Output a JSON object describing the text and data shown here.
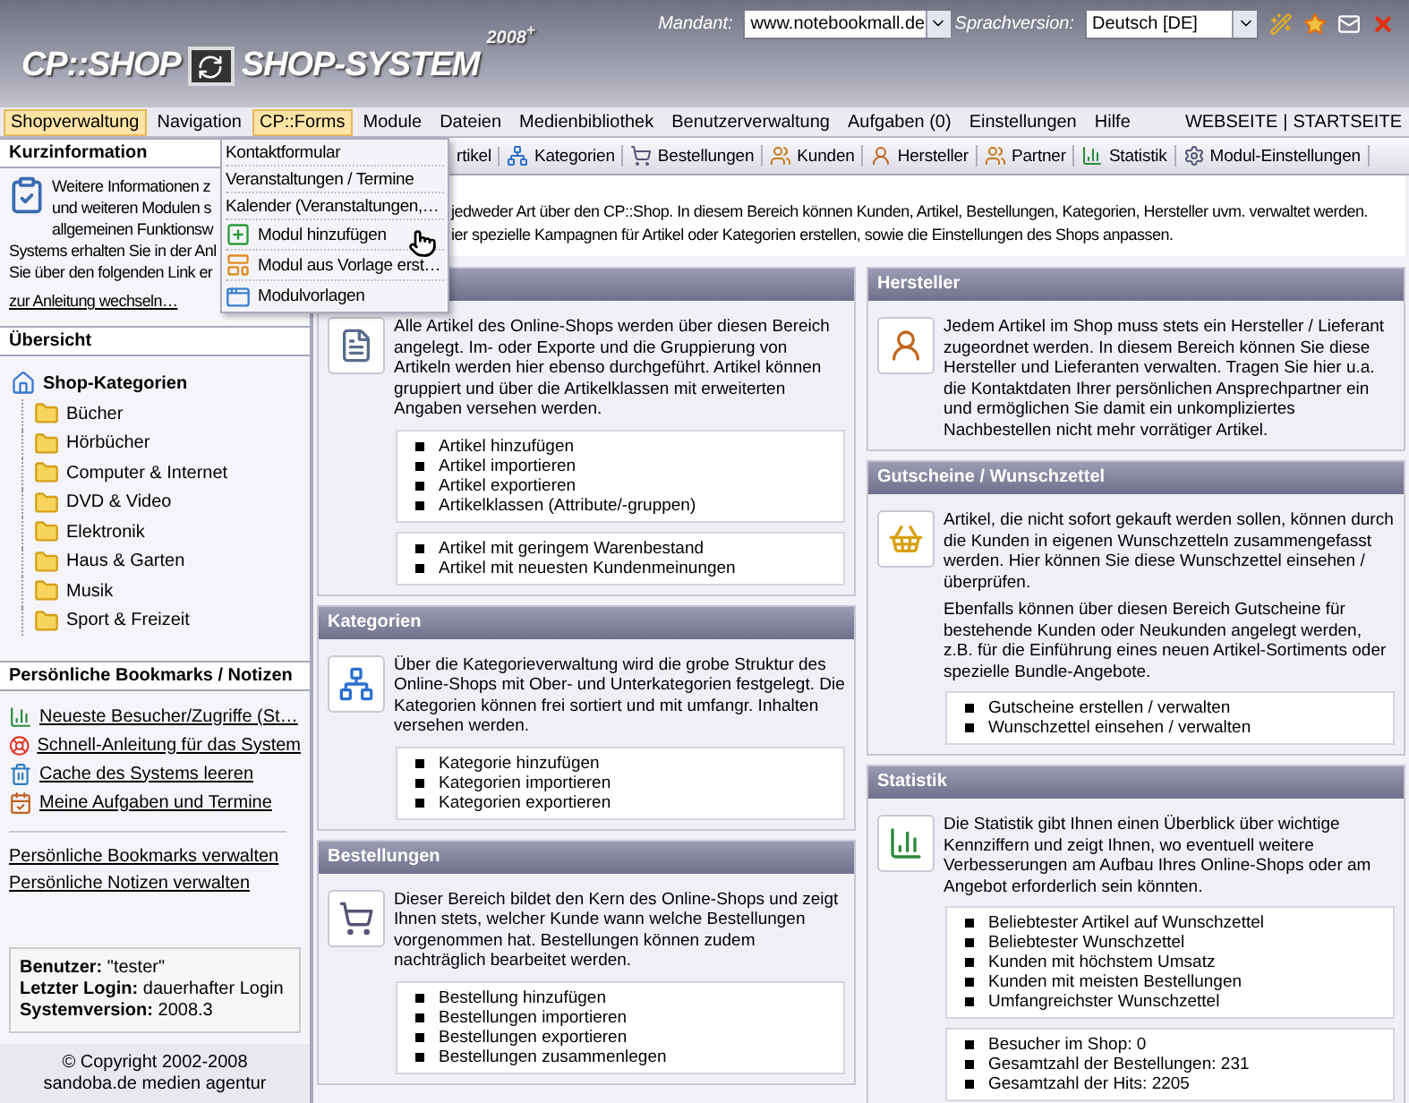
{
  "header": {
    "logo_left": "CP::SHOP",
    "logo_right": "SHOP-SYSTEM",
    "logo_year": "2008$^{+}$",
    "mandant_label": "Mandant:",
    "mandant_value": "www.notebookmall.de",
    "language_label": "Sprachversion:",
    "language_value": "Deutsch [DE]"
  },
  "menu": {
    "items": [
      {
        "label": "Shopverwaltung",
        "highlighted": true
      },
      {
        "label": "Navigation",
        "highlighted": false
      },
      {
        "label": "CP::Forms",
        "highlighted": true
      },
      {
        "label": "Module",
        "highlighted": false
      },
      {
        "label": "Dateien",
        "highlighted": false
      },
      {
        "label": "Medienbibliothek",
        "highlighted": false
      },
      {
        "label": "Benutzerverwaltung",
        "highlighted": false
      },
      {
        "label": "Aufgaben (0)",
        "highlighted": false
      },
      {
        "label": "Einstellungen",
        "highlighted": false
      },
      {
        "label": "Hilfe",
        "highlighted": false
      }
    ],
    "right_links": [
      "WEBSEITE",
      "STARTSEITE"
    ],
    "right_separator": "|"
  },
  "dropdown": {
    "items": [
      {
        "label": "Kontaktformular",
        "kind": "plain"
      },
      {
        "label": "Veranstaltungen / Termine",
        "kind": "plain"
      },
      {
        "label": "Kalender (Veranstaltungen,…",
        "kind": "plain"
      },
      {
        "label": "Modul hinzufügen",
        "kind": "add"
      },
      {
        "label": "Modul aus Vorlage erst…",
        "kind": "template"
      },
      {
        "label": "Modulvorlagen",
        "kind": "window"
      }
    ]
  },
  "sidebar": {
    "kurzinfo": {
      "title": "Kurzinformation",
      "lines": [
        "Weitere Informationen z",
        "und weiteren Modulen s",
        "allgemeinen Funktionsw"
      ],
      "more_lines": [
        "Systems erhalten Sie in der Anl",
        "Sie über den folgenden Link er"
      ],
      "link": "zur Anleitung wechseln…"
    },
    "overview": {
      "title": "Übersicht",
      "tree": {
        "label": "Shop-Kategorien",
        "children": [
          {
            "label": "Bücher"
          },
          {
            "label": "Hörbücher"
          },
          {
            "label": "Computer & Internet"
          },
          {
            "label": "DVD & Video"
          },
          {
            "label": "Elektronik"
          },
          {
            "label": "Haus & Garten"
          },
          {
            "label": "Musik"
          },
          {
            "label": "Sport & Freizeit"
          }
        ]
      }
    },
    "bookmarks": {
      "title": "Persönliche Bookmarks / Notizen",
      "links": [
        {
          "label": "Neueste Besucher/Zugriffe (St…",
          "kind": "chart"
        },
        {
          "label": "Schnell-Anleitung für das System",
          "kind": "help"
        },
        {
          "label": "Cache des Systems leeren",
          "kind": "bin"
        },
        {
          "label": "Meine Aufgaben und Termine",
          "kind": "calendar"
        }
      ],
      "manage_links": [
        "Persönliche Bookmarks verwalten",
        "Persönliche Notizen verwalten"
      ]
    },
    "user_info": [
      {
        "label": "Benutzer:",
        "value": "\"tester\""
      },
      {
        "label": "Letzter Login:",
        "value": "dauerhafter Login"
      },
      {
        "label": "Systemversion:",
        "value": "2008.3"
      }
    ],
    "copyright": [
      "© Copyright 2002-2008",
      "sandoba.de medien agentur"
    ]
  },
  "tabs": [
    {
      "label": "rtikel",
      "kind": "plain"
    },
    {
      "label": "Kategorien",
      "kind": "tree"
    },
    {
      "label": "Bestellungen",
      "kind": "cart"
    },
    {
      "label": "Kunden",
      "kind": "users"
    },
    {
      "label": "Hersteller",
      "kind": "user"
    },
    {
      "label": "Partner",
      "kind": "users"
    },
    {
      "label": "Statistik",
      "kind": "chart"
    },
    {
      "label": "Modul-Einstellungen",
      "kind": "settings"
    }
  ],
  "intro": [
    "jedweder Art über den CP::Shop. In diesem Bereich können Kunden, Artikel, Bestellungen, Kategorien, Hersteller uvm. verwaltet werden.",
    "ier spezielle Kampagnen für Artikel oder Kategorien erstellen, sowie die Einstellungen des Shops anpassen."
  ],
  "panels": {
    "left": [
      {
        "kind": "doc",
        "text": [
          "Alle Artikel des Online-Shops werden über diesen Bereich angelegt. Im- oder Exporte und die Gruppierung von Artikeln werden hier ebenso durchgeführt. Artikel können gruppiert und über die Artikelklassen mit erweiterten Angaben versehen werden."
        ],
        "lists": [
          [
            "Artikel hinzufügen",
            "Artikel importieren",
            "Artikel exportieren",
            "Artikelklassen (Attribute/-gruppen)"
          ],
          [
            "Artikel mit geringem Warenbestand",
            "Artikel mit neuesten Kundenmeinungen"
          ]
        ]
      },
      {
        "title": "Kategorien",
        "kind": "tree",
        "text": [
          "Über die Kategorieverwaltung wird die grobe Struktur des Online-Shops mit Ober- und Unterkategorien festgelegt. Die Kategorien können frei sortiert und mit umfangr. Inhalten versehen werden."
        ],
        "lists": [
          [
            "Kategorie hinzufügen",
            "Kategorien importieren",
            "Kategorien exportieren"
          ]
        ]
      },
      {
        "title": "Bestellungen",
        "kind": "cart",
        "text": [
          "Dieser Bereich bildet den Kern des Online-Shops und zeigt Ihnen stets, welcher Kunde wann welche Bestellungen vorgenommen hat. Bestellungen können zudem nachträglich bearbeitet werden."
        ],
        "lists": [
          [
            "Bestellung hinzufügen",
            "Bestellungen importieren",
            "Bestellungen exportieren",
            "Bestellungen zusammenlegen"
          ]
        ]
      }
    ],
    "right": [
      {
        "title": "Hersteller",
        "kind": "user",
        "text": [
          "Jedem Artikel im Shop muss stets ein Hersteller / Lieferant zugeordnet werden. In diesem Bereich können Sie diese Hersteller und Lieferanten verwalten. Tragen Sie hier u.a. die Kontaktdaten Ihrer persönlichen Ansprechpartner ein und ermöglichen Sie damit ein unkompliziertes Nachbestellen nicht mehr vorrätiger Artikel."
        ]
      },
      {
        "title": "Gutscheine / Wunschzettel",
        "kind": "basket",
        "text": [
          "Artikel, die nicht sofort gekauft werden sollen, können durch die Kunden in eigenen Wunschzetteln zusammengefasst werden. Hier können Sie diese Wunschzettel einsehen / überprüfen.",
          "Ebenfalls können über diesen Bereich Gutscheine für bestehende Kunden oder Neukunden angelegt werden, z.B. für die Einführung eines neuen Artikel-Sortiments oder spezielle Bundle-Angebote."
        ],
        "lists": [
          [
            "Gutscheine erstellen / verwalten",
            "Wunschzettel einsehen / verwalten"
          ]
        ]
      },
      {
        "title": "Statistik",
        "kind": "chart",
        "text": [
          "Die Statistik gibt Ihnen einen Überblick über wichtige Kennziffern und zeigt Ihnen, wo eventuell weitere Verbesserungen am Aufbau Ihres Online-Shops oder am Angebot erforderlich sein könnten."
        ],
        "lists": [
          [
            "Beliebtester Artikel auf Wunschzettel",
            "Beliebtester Wunschzettel",
            "Kunden mit höchstem Umsatz",
            "Kunden mit meisten Bestellungen",
            "Umfangreichster Wunschzettel"
          ],
          [
            "Besucher im Shop: 0",
            "Gesamtzahl der Bestellungen: 231",
            "Gesamtzahl der Hits: 2205"
          ]
        ]
      }
    ]
  }
}
